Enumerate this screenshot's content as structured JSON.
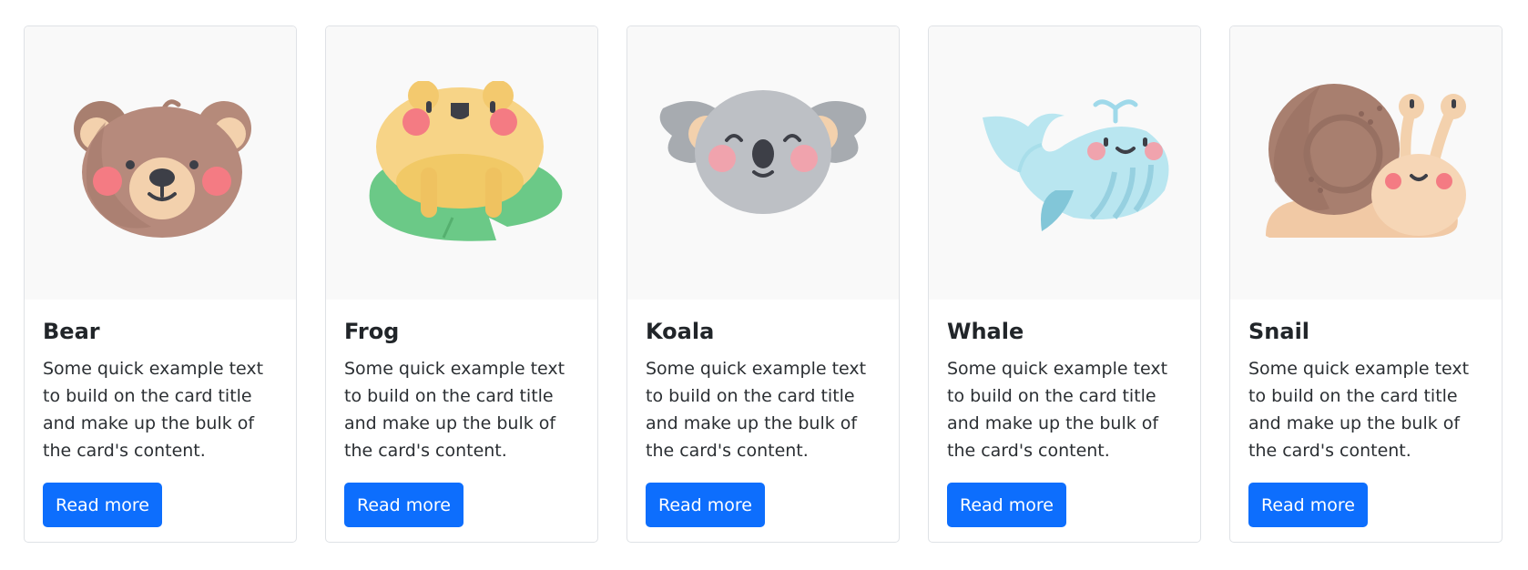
{
  "colors": {
    "button": "#0d6efd",
    "image_bg": "#f9f9f9",
    "card_border": "#dfe2e6"
  },
  "cards": [
    {
      "title": "Bear",
      "text": "Some quick example text to build on the card title and make up the bulk of the card's content.",
      "button_label": "Read more",
      "icon": "bear-icon"
    },
    {
      "title": "Frog",
      "text": "Some quick example text to build on the card title and make up the bulk of the card's content.",
      "button_label": "Read more",
      "icon": "frog-icon"
    },
    {
      "title": "Koala",
      "text": "Some quick example text to build on the card title and make up the bulk of the card's content.",
      "button_label": "Read more",
      "icon": "koala-icon"
    },
    {
      "title": "Whale",
      "text": "Some quick example text to build on the card title and make up the bulk of the card's content.",
      "button_label": "Read more",
      "icon": "whale-icon"
    },
    {
      "title": "Snail",
      "text": "Some quick example text to build on the card title and make up the bulk of the card's content.",
      "button_label": "Read more",
      "icon": "snail-icon"
    }
  ]
}
